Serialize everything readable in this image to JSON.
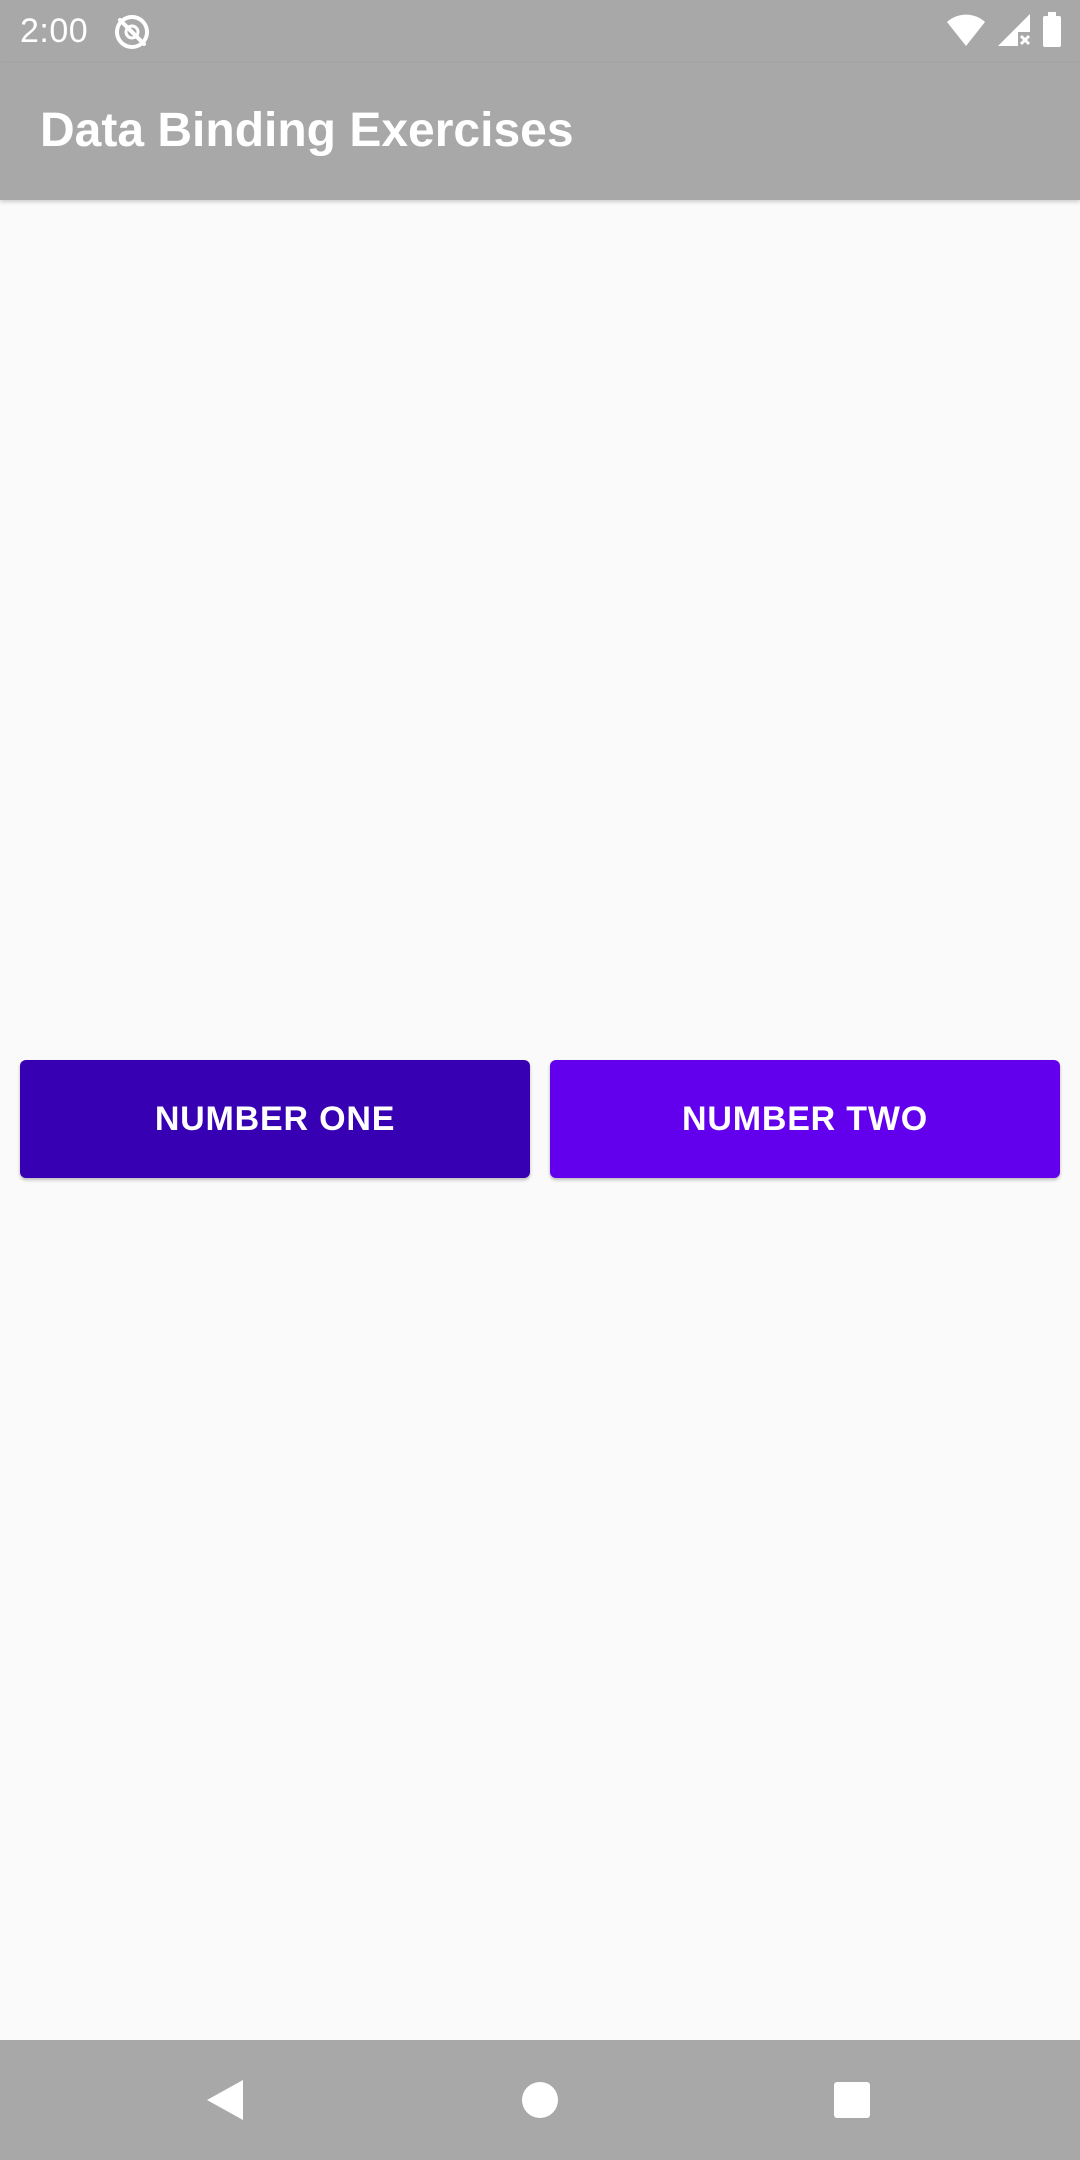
{
  "status_bar": {
    "time": "2:00",
    "left_icon": "location-off-icon",
    "right_icons": [
      "wifi-icon",
      "signal-no-data-icon",
      "battery-icon"
    ]
  },
  "app_bar": {
    "title": "Data Binding Exercises"
  },
  "buttons": {
    "one": {
      "label": "NUMBER ONE",
      "color": "#3700B3"
    },
    "two": {
      "label": "NUMBER TWO",
      "color": "#6200EE"
    }
  },
  "nav_bar": {
    "items": [
      "back-icon",
      "home-icon",
      "recents-icon"
    ]
  },
  "colors": {
    "bars": "#A8A8A8",
    "background": "#FAFAFA"
  }
}
